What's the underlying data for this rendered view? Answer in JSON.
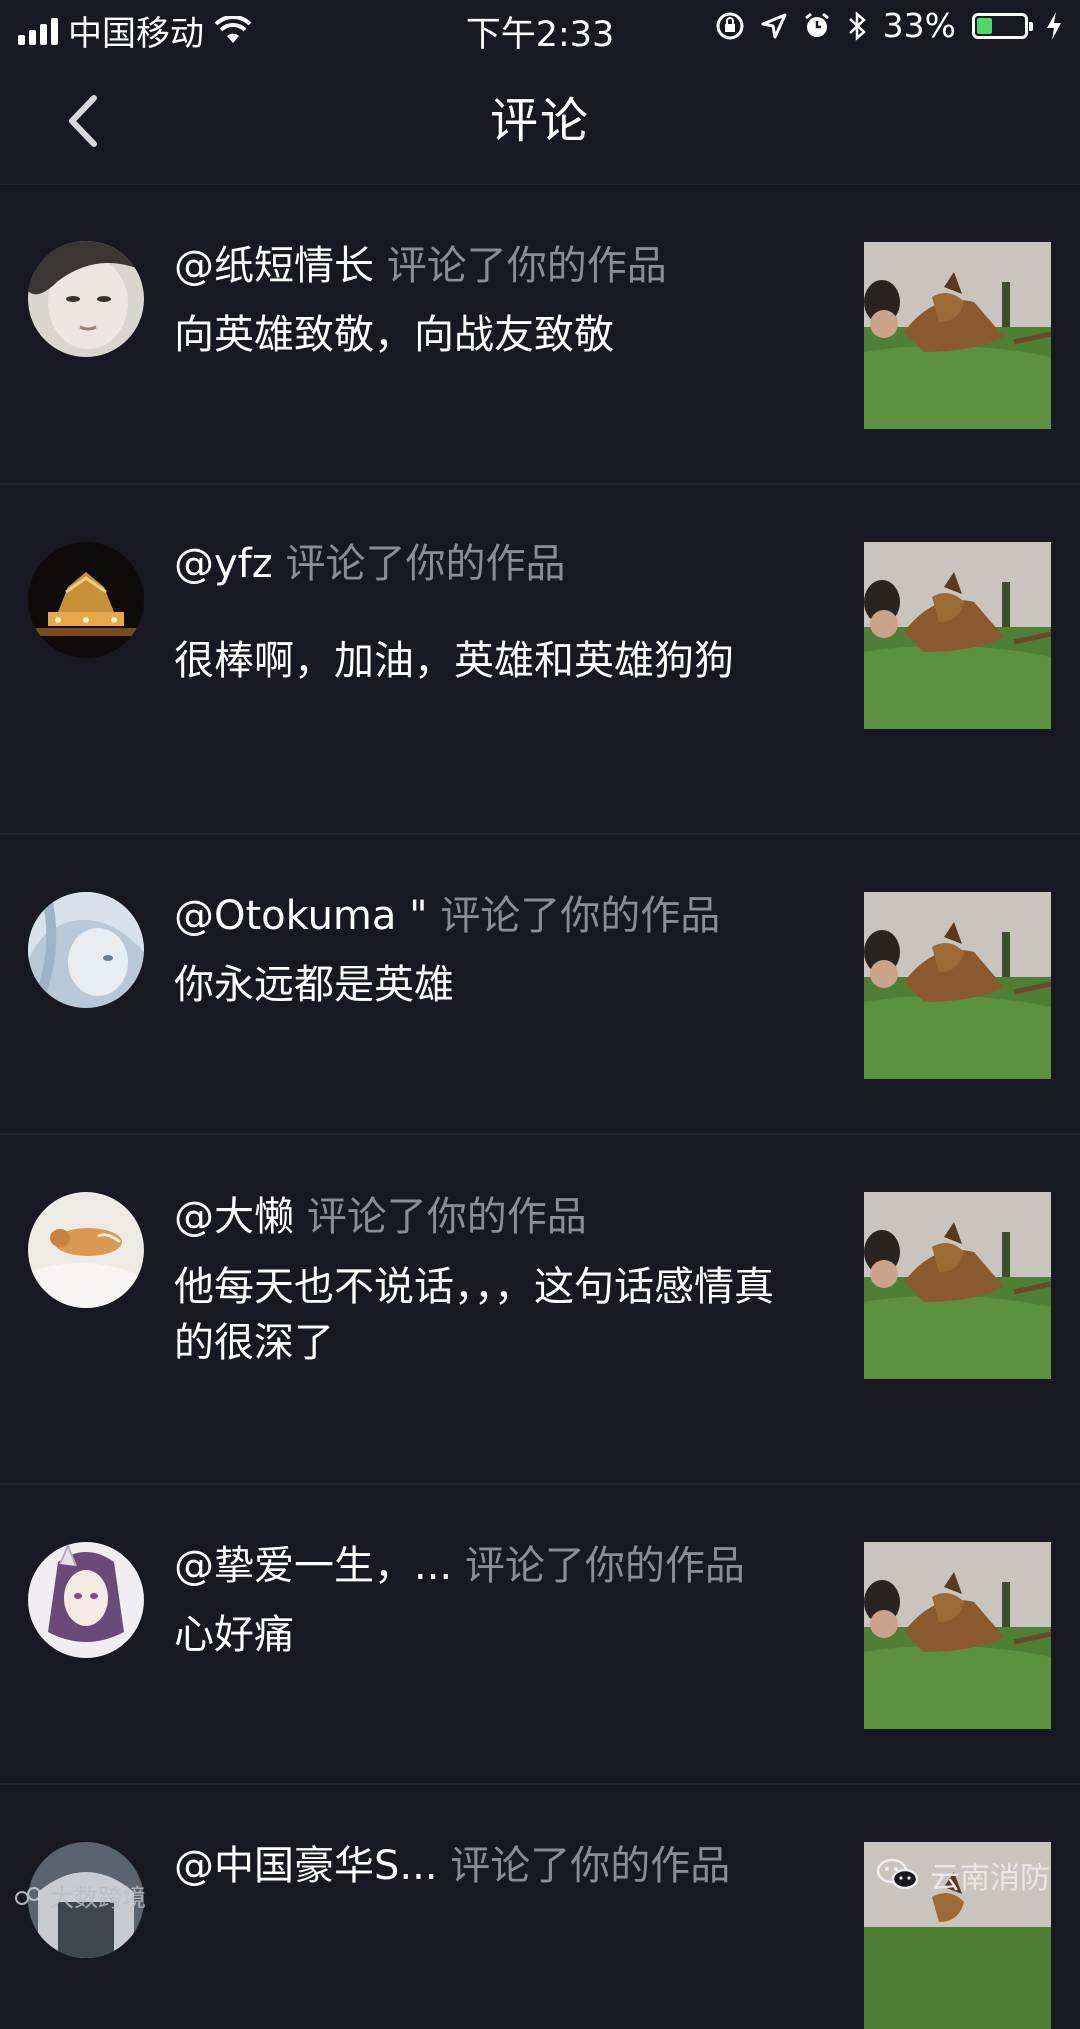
{
  "status_bar": {
    "carrier": "中国移动",
    "time": "下午2:33",
    "battery": "33%",
    "battery_level": 0.33
  },
  "header": {
    "title": "评论"
  },
  "comments": [
    {
      "user": "@纸短情长",
      "action": "评论了你的作品",
      "text": "向英雄致敬，向战友致敬"
    },
    {
      "user": "@yfz",
      "action": "评论了你的作品",
      "text": "很棒啊，加油，英雄和英雄狗狗"
    },
    {
      "user": "@Otokuma \"",
      "action": "评论了你的作品",
      "text": "你永远都是英雄"
    },
    {
      "user": "@大懒",
      "action": "评论了你的作品",
      "text": "他每天也不说话，，，这句话感情真的很深了"
    },
    {
      "user": "@挚爱一生，...",
      "action": "评论了你的作品",
      "text": "心好痛"
    },
    {
      "user": "@中国豪华S...",
      "action": "评论了你的作品",
      "text": ""
    }
  ],
  "watermarks": {
    "left": "大数跨境",
    "right": "云南消防"
  },
  "colors": {
    "background": "#171821",
    "secondary_text": "#8b8c94",
    "divider": "#242530"
  }
}
